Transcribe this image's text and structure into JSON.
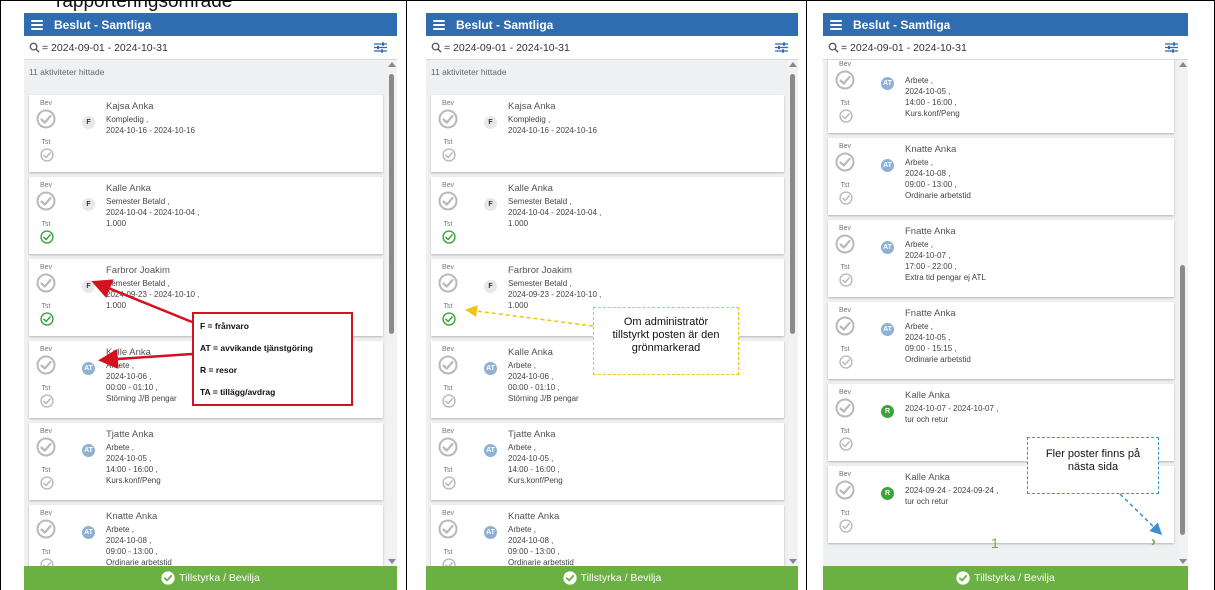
{
  "doc_heading": "rapporteringsområde",
  "app": {
    "title": "Beslut - Samtliga",
    "date_range": "= 2024-09-01 - 2024-10-31",
    "result_count": "11 aktiviteter hittade",
    "approve_button": "Tillstyrka / Bevilja",
    "label_bev": "Bev",
    "label_tst": "Tst"
  },
  "colors": {
    "header_blue": "#2f6db0",
    "approve_green": "#6ab042",
    "legend_red": "#d4111e",
    "callout_yellow": "#f1c40f",
    "callout_blue": "#3a8fd6"
  },
  "icons": {
    "menu": "hamburger-icon",
    "search": "search-icon",
    "filter": "filter-sliders-icon",
    "check": "check-circle-icon",
    "next": "chevron-right-icon"
  },
  "screens": [
    {
      "cards": [
        {
          "name": "Kajsa Anka",
          "badge": "F",
          "tst_approved": false,
          "lines": [
            "Kompledig ,",
            "2024-10-16 - 2024-10-16"
          ]
        },
        {
          "name": "Kalle Anka",
          "badge": "F",
          "tst_approved": true,
          "lines": [
            "Semester Betald ,",
            "2024-10-04 - 2024-10-04 ,",
            "1.000"
          ]
        },
        {
          "name": "Farbror Joakim",
          "badge": "F",
          "tst_approved": true,
          "lines": [
            "Semester Betald ,",
            "2024-09-23 - 2024-10-10 ,",
            "1.000"
          ]
        },
        {
          "name": "Kalle Anka",
          "badge": "AT",
          "tst_approved": false,
          "lines": [
            "Arbete ,",
            "2024-10-06 ,",
            "00:00 - 01:10 ,",
            "Störning J/B pengar"
          ]
        },
        {
          "name": "Tjatte Anka",
          "badge": "AT",
          "tst_approved": false,
          "lines": [
            "Arbete ,",
            "2024-10-05 ,",
            "14:00 - 16:00 ,",
            "Kurs.konf/Peng"
          ]
        },
        {
          "name": "Knatte Anka",
          "badge": "AT",
          "tst_approved": false,
          "lines": [
            "Arbete ,",
            "2024-10-08 ,",
            "09:00 - 13:00 ,",
            "Ordinarie arbetstid"
          ]
        }
      ]
    },
    {
      "cards": [
        {
          "name": "Kajsa Anka",
          "badge": "F",
          "tst_approved": false,
          "lines": [
            "Kompledig ,",
            "2024-10-16 - 2024-10-16"
          ]
        },
        {
          "name": "Kalle Anka",
          "badge": "F",
          "tst_approved": true,
          "lines": [
            "Semester Betald ,",
            "2024-10-04 - 2024-10-04 ,",
            "1.000"
          ]
        },
        {
          "name": "Farbror Joakim",
          "badge": "F",
          "tst_approved": true,
          "lines": [
            "Semester Betald ,",
            "2024-09-23 - 2024-10-10 ,",
            "1.000"
          ]
        },
        {
          "name": "Kalle Anka",
          "badge": "AT",
          "tst_approved": false,
          "lines": [
            "Arbete ,",
            "2024-10-06 ,",
            "00:00 - 01:10 ,",
            "Störning J/B pengar"
          ]
        },
        {
          "name": "Tjatte Anka",
          "badge": "AT",
          "tst_approved": false,
          "lines": [
            "Arbete ,",
            "2024-10-05 ,",
            "14:00 - 16:00 ,",
            "Kurs.konf/Peng"
          ]
        },
        {
          "name": "Knatte Anka",
          "badge": "AT",
          "tst_approved": false,
          "lines": [
            "Arbete ,",
            "2024-10-08 ,",
            "09:00 - 13:00 ,",
            "Ordinarie arbetstid"
          ]
        }
      ]
    },
    {
      "cards": [
        {
          "name": "",
          "badge": "AT",
          "tst_approved": false,
          "lines": [
            "Arbete ,",
            "2024-10-05 ,",
            "14:00 - 16:00 ,",
            "Kurs.konf/Peng"
          ]
        },
        {
          "name": "Knatte Anka",
          "badge": "AT",
          "tst_approved": false,
          "lines": [
            "Arbete ,",
            "2024-10-08 ,",
            "09:00 - 13:00 ,",
            "Ordinarie arbetstid"
          ]
        },
        {
          "name": "Fnatte Anka",
          "badge": "AT",
          "tst_approved": false,
          "lines": [
            "Arbete ,",
            "2024-10-07 ,",
            "17:00 - 22:00 ,",
            "Extra tid pengar ej ATL"
          ]
        },
        {
          "name": "Fnatte Anka",
          "badge": "AT",
          "tst_approved": false,
          "lines": [
            "Arbete ,",
            "2024-10-05 ,",
            "09:00 - 15:15 ,",
            "Ordinarie arbetstid"
          ]
        },
        {
          "name": "Kalle Anka",
          "badge": "R",
          "tst_approved": false,
          "lines": [
            "2024-10-07 - 2024-10-07 ,",
            "tur och retur"
          ]
        },
        {
          "name": "Kalle Anka",
          "badge": "R",
          "tst_approved": false,
          "lines": [
            "2024-09-24 - 2024-09-24 ,",
            "tur och retur"
          ]
        }
      ],
      "page_number": "1"
    }
  ],
  "legend": [
    "F = frånvaro",
    "AT = avvikande tjänstgöring",
    "R = resor",
    "TA = tillägg/avdrag"
  ],
  "callouts": {
    "approved": [
      "Om administratör",
      "tillstyrkt posten är den",
      "grönmarkerad"
    ],
    "more_pages": [
      "Fler poster finns på",
      "nästa sida"
    ]
  }
}
